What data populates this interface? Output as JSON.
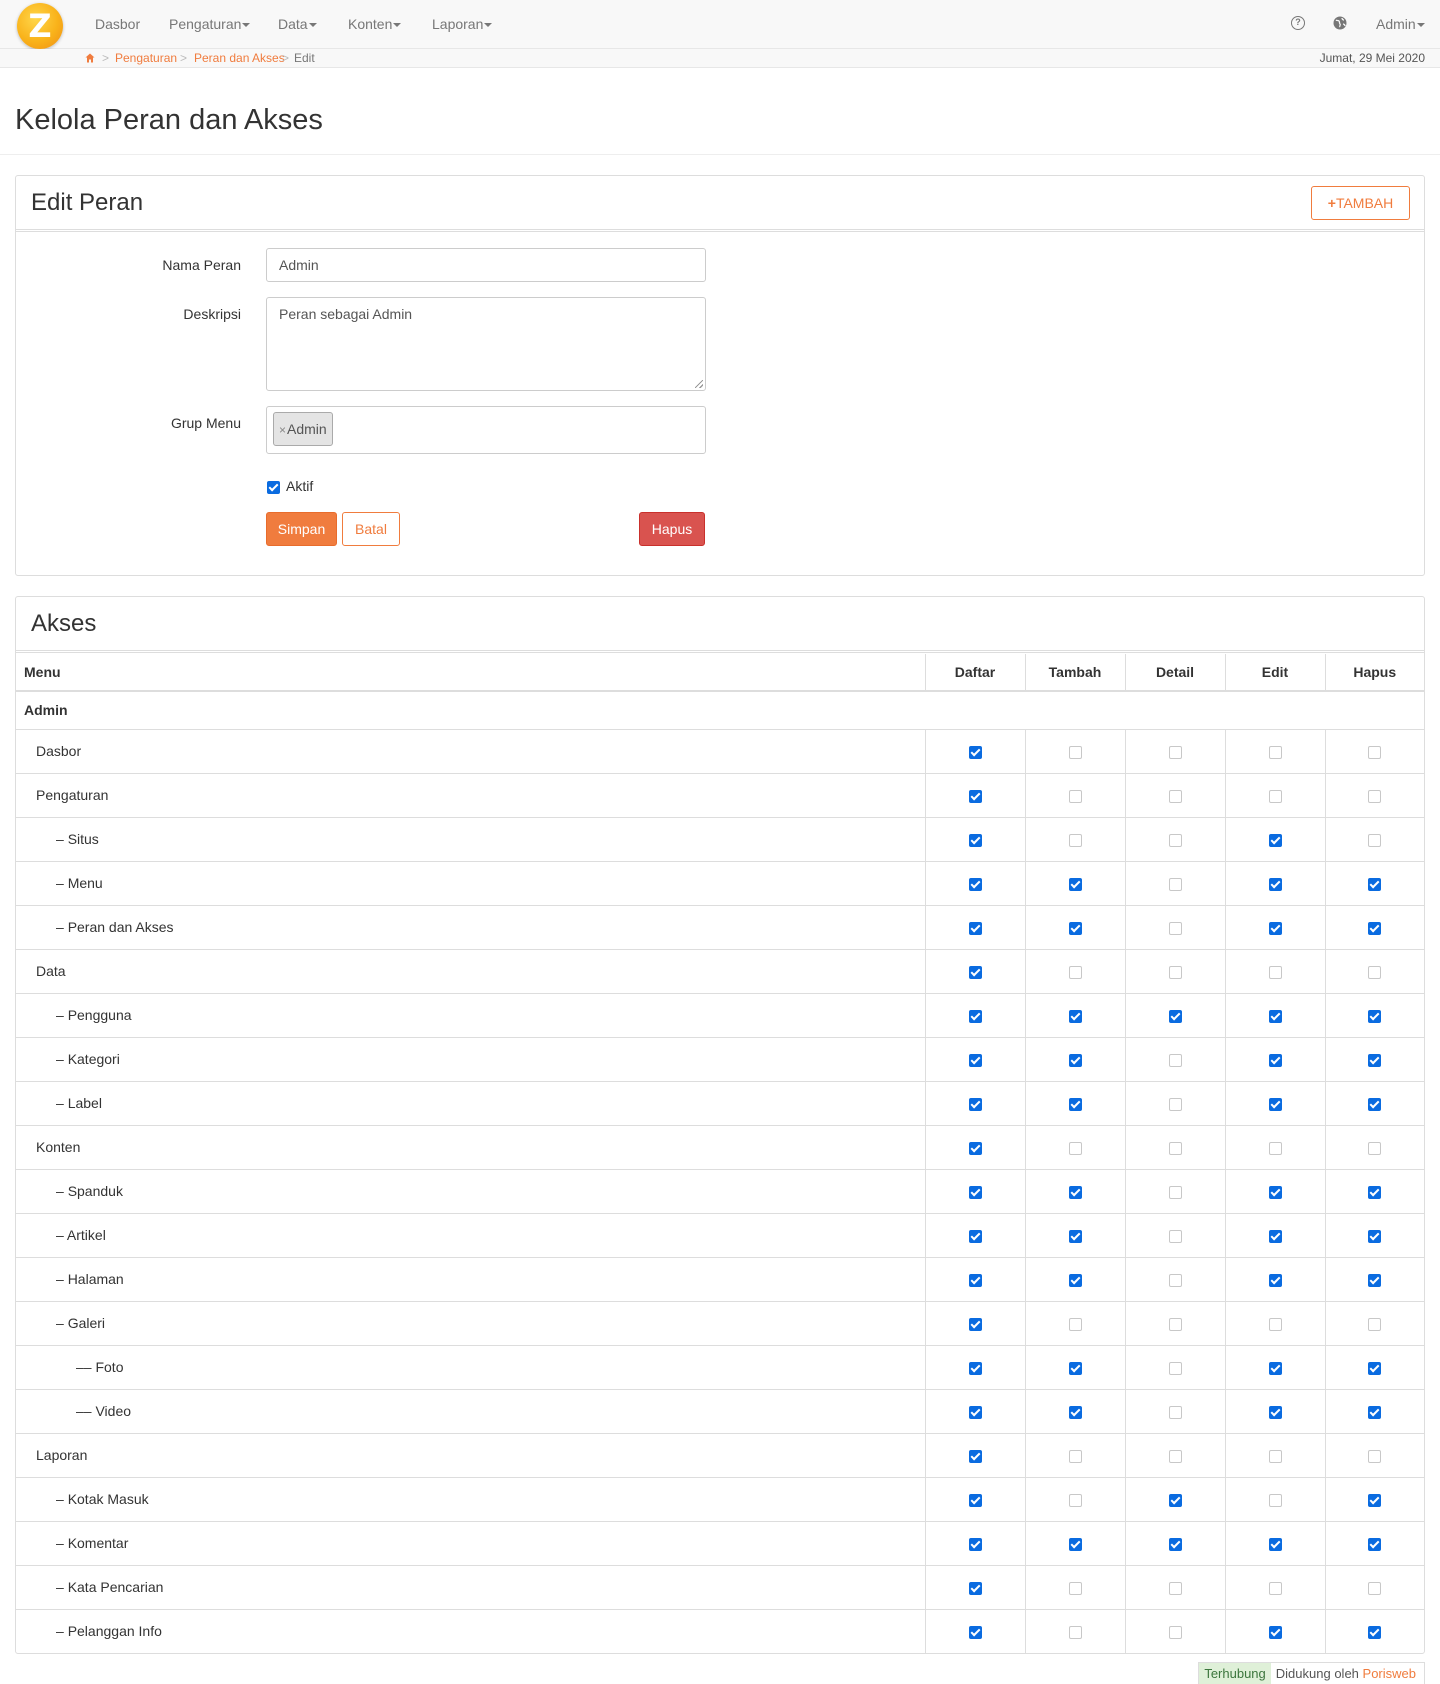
{
  "navbar": {
    "logo_letter": "Z",
    "items": [
      {
        "label": "Dasbor",
        "dropdown": false
      },
      {
        "label": "Pengaturan",
        "dropdown": true
      },
      {
        "label": "Data",
        "dropdown": true
      },
      {
        "label": "Konten",
        "dropdown": true
      },
      {
        "label": "Laporan",
        "dropdown": true
      }
    ],
    "help_icon": "question-circle-icon",
    "globe_icon": "globe-icon",
    "user_label": "Admin"
  },
  "breadcrumb": {
    "home_icon": "home-icon",
    "items": [
      "Pengaturan",
      "Peran dan Akses",
      "Edit"
    ],
    "separator": ">"
  },
  "date": "Jumat, 29 Mei 2020",
  "page_title": "Kelola Peran dan Akses",
  "edit_panel": {
    "title": "Edit Peran",
    "add_button": "TAMBAH",
    "fields": {
      "name_label": "Nama Peran",
      "name_value": "Admin",
      "description_label": "Deskripsi",
      "description_value": "Peran sebagai Admin",
      "menu_group_label": "Grup Menu",
      "menu_group_tags": [
        "Admin"
      ],
      "active_label": "Aktif",
      "active_checked": true
    },
    "buttons": {
      "save": "Simpan",
      "cancel": "Batal",
      "delete": "Hapus"
    }
  },
  "access_panel": {
    "title": "Akses",
    "columns": [
      "Menu",
      "Daftar",
      "Tambah",
      "Detail",
      "Edit",
      "Hapus"
    ],
    "group": "Admin",
    "rows": [
      {
        "name": "Dasbor",
        "prefix": "",
        "level": 0,
        "perms": [
          true,
          false,
          false,
          false,
          false
        ]
      },
      {
        "name": "Pengaturan",
        "prefix": "",
        "level": 0,
        "perms": [
          true,
          false,
          false,
          false,
          false
        ]
      },
      {
        "name": "Situs",
        "prefix": "– ",
        "level": 1,
        "perms": [
          true,
          false,
          false,
          true,
          false
        ]
      },
      {
        "name": "Menu",
        "prefix": "– ",
        "level": 1,
        "perms": [
          true,
          true,
          false,
          true,
          true
        ]
      },
      {
        "name": "Peran dan Akses",
        "prefix": "– ",
        "level": 1,
        "perms": [
          true,
          true,
          false,
          true,
          true
        ]
      },
      {
        "name": "Data",
        "prefix": "",
        "level": 0,
        "perms": [
          true,
          false,
          false,
          false,
          false
        ]
      },
      {
        "name": "Pengguna",
        "prefix": "– ",
        "level": 1,
        "perms": [
          true,
          true,
          true,
          true,
          true
        ]
      },
      {
        "name": "Kategori",
        "prefix": "– ",
        "level": 1,
        "perms": [
          true,
          true,
          false,
          true,
          true
        ]
      },
      {
        "name": "Label",
        "prefix": "– ",
        "level": 1,
        "perms": [
          true,
          true,
          false,
          true,
          true
        ]
      },
      {
        "name": "Konten",
        "prefix": "",
        "level": 0,
        "perms": [
          true,
          false,
          false,
          false,
          false
        ]
      },
      {
        "name": "Spanduk",
        "prefix": "– ",
        "level": 1,
        "perms": [
          true,
          true,
          false,
          true,
          true
        ]
      },
      {
        "name": "Artikel",
        "prefix": "– ",
        "level": 1,
        "perms": [
          true,
          true,
          false,
          true,
          true
        ]
      },
      {
        "name": "Halaman",
        "prefix": "– ",
        "level": 1,
        "perms": [
          true,
          true,
          false,
          true,
          true
        ]
      },
      {
        "name": "Galeri",
        "prefix": "– ",
        "level": 1,
        "perms": [
          true,
          false,
          false,
          false,
          false
        ]
      },
      {
        "name": "Foto",
        "prefix": "–– ",
        "level": 2,
        "perms": [
          true,
          true,
          false,
          true,
          true
        ]
      },
      {
        "name": "Video",
        "prefix": "–– ",
        "level": 2,
        "perms": [
          true,
          true,
          false,
          true,
          true
        ]
      },
      {
        "name": "Laporan",
        "prefix": "",
        "level": 0,
        "perms": [
          true,
          false,
          false,
          false,
          false
        ]
      },
      {
        "name": "Kotak Masuk",
        "prefix": "– ",
        "level": 1,
        "perms": [
          true,
          false,
          true,
          false,
          true
        ]
      },
      {
        "name": "Komentar",
        "prefix": "– ",
        "level": 1,
        "perms": [
          true,
          true,
          true,
          true,
          true
        ]
      },
      {
        "name": "Kata Pencarian",
        "prefix": "– ",
        "level": 1,
        "perms": [
          true,
          false,
          false,
          false,
          false
        ]
      },
      {
        "name": "Pelanggan Info",
        "prefix": "– ",
        "level": 1,
        "perms": [
          true,
          false,
          false,
          true,
          true
        ]
      }
    ]
  },
  "footer": {
    "status": "Terhubung",
    "powered_by": "Didukung oleh",
    "brand": "Porisweb"
  },
  "colors": {
    "accent": "#f07c3e",
    "danger": "#d9534f",
    "checkbox": "#0a6be0",
    "status_bg": "#dff0d8"
  }
}
